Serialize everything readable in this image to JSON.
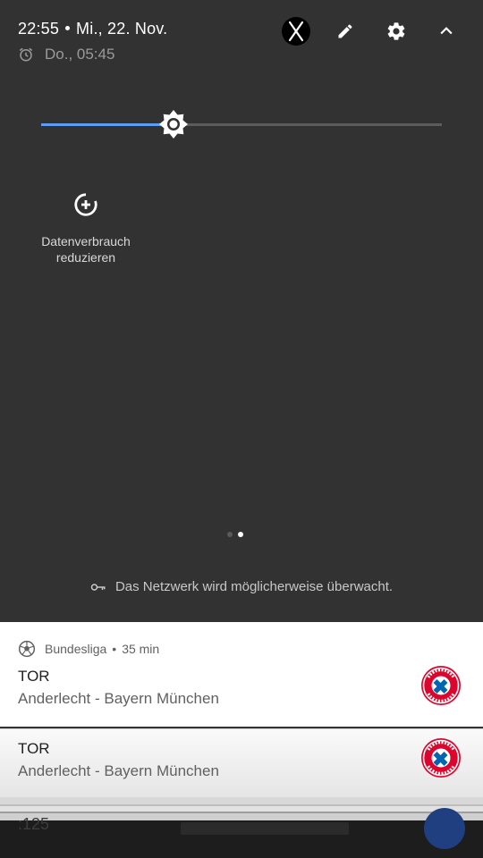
{
  "status": {
    "time": "22:55",
    "date": "Mi., 22. Nov.",
    "alarm": "Do., 05:45"
  },
  "top_icons": [
    "x-logo-icon",
    "pencil-icon",
    "gear-icon",
    "chevron-up-icon"
  ],
  "brightness": {
    "level": 0.33
  },
  "tiles": [
    {
      "label_line1": "Datenverbrauch",
      "label_line2": "reduzieren",
      "icon": "data-saver-icon"
    }
  ],
  "pagination": {
    "pages": 2,
    "active": 2
  },
  "network_notice": "Das Netzwerk wird möglicherweise überwacht.",
  "notifications": [
    {
      "app": "Bundesliga",
      "age": "35 min",
      "title": "TOR",
      "text": "Anderlecht - Bayern München",
      "icon": "soccer-ball-icon",
      "logo": "fc-bayern-logo"
    },
    {
      "title": "TOR",
      "text": "Anderlecht - Bayern München",
      "logo": "fc-bayern-logo"
    }
  ],
  "background_app_text": ":125",
  "colors": {
    "panel": "#323232",
    "accent": "#5b9df6",
    "card": "#ffffff",
    "bayern_red": "#dc052d",
    "bayern_blue": "#0066b2"
  }
}
